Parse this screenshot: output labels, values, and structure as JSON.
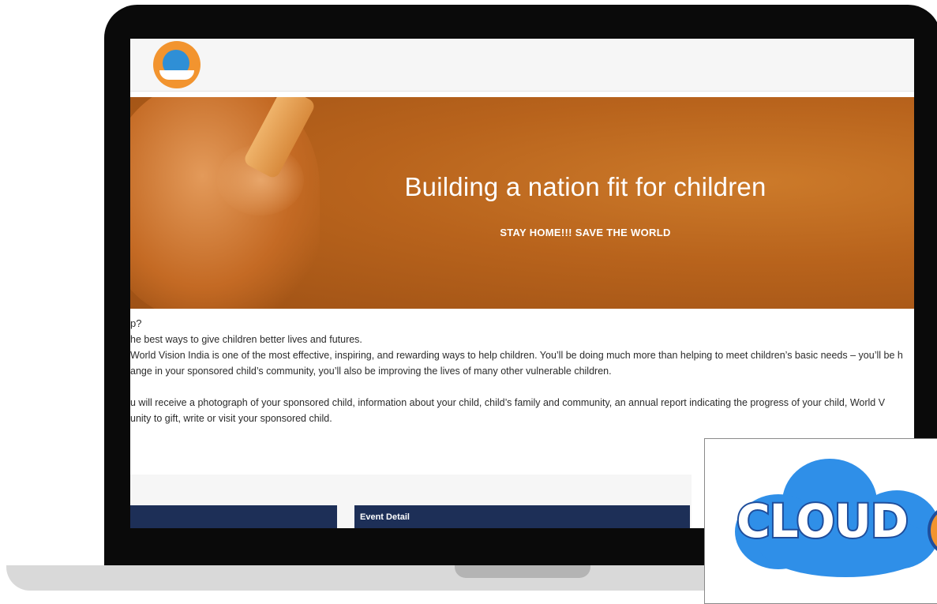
{
  "hero": {
    "title": "Building a nation fit for children",
    "subtitle": "STAY HOME!!! SAVE THE WORLD"
  },
  "article": {
    "heading": "p?",
    "lines": [
      "he best ways to give children better lives and futures.",
      "World Vision India is one of the most effective, inspiring, and rewarding ways to help children. You’ll be doing much more than helping to meet children’s basic needs – you’ll be h",
      "ange in your sponsored child’s community, you’ll also be improving the lives of many other vulnerable children.",
      "u will receive a photograph of your sponsored child, information about your child, child’s family and community, an annual report indicating the progress of your child, World V",
      "unity to gift, write or visit your sponsored child."
    ]
  },
  "panels": {
    "left_label": "",
    "right_label": "Event Detail"
  },
  "watermark": {
    "text": "CLOUD"
  },
  "colors": {
    "accent_orange": "#f2942f",
    "navy_bar": "#1d2f57",
    "cloud_blue": "#2f8fe8"
  }
}
